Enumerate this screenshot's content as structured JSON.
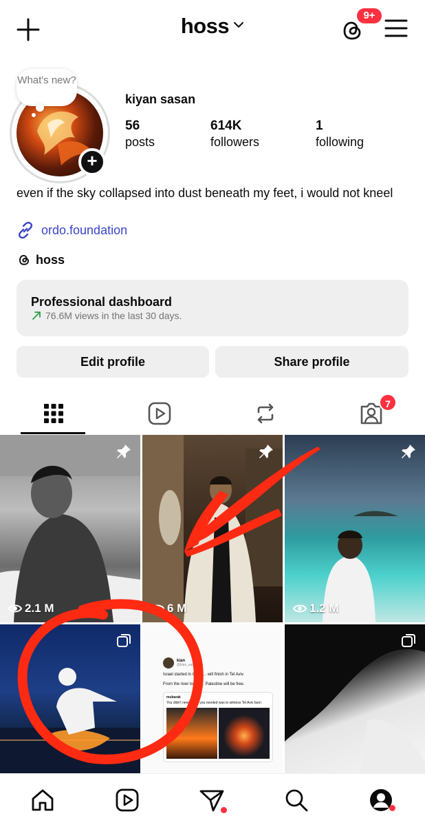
{
  "header": {
    "username": "hoss",
    "notification_badge": "9+"
  },
  "profile": {
    "note_placeholder": "What's new?",
    "full_name": "kiyan sasan",
    "stats": [
      {
        "value": "56",
        "label": "posts"
      },
      {
        "value": "614K",
        "label": "followers"
      },
      {
        "value": "1",
        "label": "following"
      }
    ],
    "bio": "even if the sky collapsed into dust beneath my feet, i would not kneel",
    "link": "ordo.foundation",
    "threads_handle": "hoss"
  },
  "dashboard": {
    "title": "Professional dashboard",
    "subtitle": "76.6M views in the last 30 days."
  },
  "buttons": {
    "edit": "Edit profile",
    "share": "Share profile"
  },
  "tabs": {
    "tagged_badge": "7"
  },
  "posts": [
    {
      "views": "2.1 M",
      "pinned": true
    },
    {
      "views": "6 M",
      "pinned": true
    },
    {
      "views": "1.2 M",
      "pinned": true
    },
    {
      "multi": true
    },
    {
      "tweet_name": "kian",
      "tweet_handle": "@kian_sasan",
      "tweet_line1": "Israel started in Gaza… will finish in Tel Aviv.",
      "tweet_line2": "From the river to the… Palestine will be free.",
      "quote_name": "mubarak",
      "quote_text": "You didn't need … all you needed was to witness Tel Aviv burn"
    },
    {
      "multi": true
    }
  ],
  "colors": {
    "accent_red": "#ff3040",
    "link_blue": "#3a44c8",
    "annotation_red": "#ff2a12"
  }
}
